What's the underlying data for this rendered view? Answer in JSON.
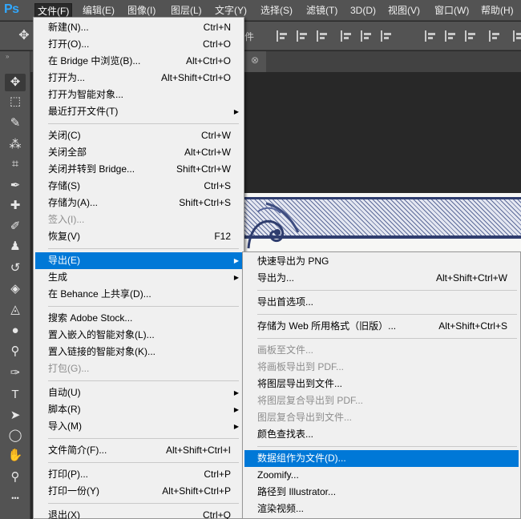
{
  "app": {
    "logo": "Ps"
  },
  "menubar": {
    "items": [
      {
        "label": "文件(F)"
      },
      {
        "label": "编辑(E)"
      },
      {
        "label": "图像(I)"
      },
      {
        "label": "图层(L)"
      },
      {
        "label": "文字(Y)"
      },
      {
        "label": "选择(S)"
      },
      {
        "label": "滤镜(T)"
      },
      {
        "label": "3D(D)"
      },
      {
        "label": "视图(V)"
      },
      {
        "label": "窗口(W)"
      },
      {
        "label": "帮助(H)"
      }
    ],
    "active_index": 0
  },
  "optionsbar": {
    "partial_label": "件"
  },
  "tab": {
    "close_glyph": "⊗"
  },
  "toolbox": {
    "collapse_glyph": "»",
    "tools": [
      {
        "icon": "move-tool-icon",
        "glyph": "✥"
      },
      {
        "icon": "marquee-tool-icon",
        "glyph": "⬚"
      },
      {
        "icon": "quick-select-tool-icon",
        "glyph": "✎"
      },
      {
        "icon": "magic-wand-tool-icon",
        "glyph": "⁂"
      },
      {
        "icon": "crop-tool-icon",
        "glyph": "⌗"
      },
      {
        "icon": "eyedropper-tool-icon",
        "glyph": "✒"
      },
      {
        "icon": "healing-brush-tool-icon",
        "glyph": "✚"
      },
      {
        "icon": "brush-tool-icon",
        "glyph": "✐"
      },
      {
        "icon": "clone-stamp-tool-icon",
        "glyph": "♟"
      },
      {
        "icon": "history-brush-tool-icon",
        "glyph": "↺"
      },
      {
        "icon": "eraser-tool-icon",
        "glyph": "◈"
      },
      {
        "icon": "paint-bucket-tool-icon",
        "glyph": "◬"
      },
      {
        "icon": "blur-tool-icon",
        "glyph": "●"
      },
      {
        "icon": "dodge-tool-icon",
        "glyph": "⚲"
      },
      {
        "icon": "pen-tool-icon",
        "glyph": "✑"
      },
      {
        "icon": "type-tool-icon",
        "glyph": "T"
      },
      {
        "icon": "path-select-tool-icon",
        "glyph": "➤"
      },
      {
        "icon": "ellipse-tool-icon",
        "glyph": "◯"
      },
      {
        "icon": "hand-tool-icon",
        "glyph": "✋"
      },
      {
        "icon": "zoom-tool-icon",
        "glyph": "⚲"
      },
      {
        "icon": "more-tools-icon",
        "glyph": "•••"
      }
    ]
  },
  "file_menu": {
    "items": [
      {
        "label": "新建(N)...",
        "shortcut": "Ctrl+N"
      },
      {
        "label": "打开(O)...",
        "shortcut": "Ctrl+O"
      },
      {
        "label": "在 Bridge 中浏览(B)...",
        "shortcut": "Alt+Ctrl+O"
      },
      {
        "label": "打开为...",
        "shortcut": "Alt+Shift+Ctrl+O"
      },
      {
        "label": "打开为智能对象...",
        "shortcut": ""
      },
      {
        "label": "最近打开文件(T)",
        "shortcut": "",
        "submenu": true
      },
      {
        "separator": true
      },
      {
        "label": "关闭(C)",
        "shortcut": "Ctrl+W"
      },
      {
        "label": "关闭全部",
        "shortcut": "Alt+Ctrl+W"
      },
      {
        "label": "关闭并转到 Bridge...",
        "shortcut": "Shift+Ctrl+W"
      },
      {
        "label": "存储(S)",
        "shortcut": "Ctrl+S"
      },
      {
        "label": "存储为(A)...",
        "shortcut": "Shift+Ctrl+S"
      },
      {
        "label": "签入(I)...",
        "shortcut": "",
        "disabled": true
      },
      {
        "label": "恢复(V)",
        "shortcut": "F12"
      },
      {
        "separator": true
      },
      {
        "label": "导出(E)",
        "shortcut": "",
        "submenu": true,
        "highlighted": true
      },
      {
        "label": "生成",
        "shortcut": "",
        "submenu": true
      },
      {
        "label": "在 Behance 上共享(D)...",
        "shortcut": ""
      },
      {
        "separator": true
      },
      {
        "label": "搜索 Adobe Stock...",
        "shortcut": ""
      },
      {
        "label": "置入嵌入的智能对象(L)...",
        "shortcut": ""
      },
      {
        "label": "置入链接的智能对象(K)...",
        "shortcut": ""
      },
      {
        "label": "打包(G)...",
        "shortcut": "",
        "disabled": true
      },
      {
        "separator": true
      },
      {
        "label": "自动(U)",
        "shortcut": "",
        "submenu": true
      },
      {
        "label": "脚本(R)",
        "shortcut": "",
        "submenu": true
      },
      {
        "label": "导入(M)",
        "shortcut": "",
        "submenu": true
      },
      {
        "separator": true
      },
      {
        "label": "文件简介(F)...",
        "shortcut": "Alt+Shift+Ctrl+I"
      },
      {
        "separator": true
      },
      {
        "label": "打印(P)...",
        "shortcut": "Ctrl+P"
      },
      {
        "label": "打印一份(Y)",
        "shortcut": "Alt+Shift+Ctrl+P"
      },
      {
        "separator": true
      },
      {
        "label": "退出(X)",
        "shortcut": "Ctrl+Q"
      }
    ]
  },
  "export_submenu": {
    "items": [
      {
        "label": "快速导出为 PNG",
        "shortcut": ""
      },
      {
        "label": "导出为...",
        "shortcut": "Alt+Shift+Ctrl+W"
      },
      {
        "separator": true
      },
      {
        "label": "导出首选项...",
        "shortcut": ""
      },
      {
        "separator": true
      },
      {
        "label": "存储为 Web 所用格式（旧版）...",
        "shortcut": "Alt+Shift+Ctrl+S"
      },
      {
        "separator": true
      },
      {
        "label": "画板至文件...",
        "shortcut": "",
        "disabled": true
      },
      {
        "label": "将画板导出到 PDF...",
        "shortcut": "",
        "disabled": true
      },
      {
        "label": "将图层导出到文件...",
        "shortcut": ""
      },
      {
        "label": "将图层复合导出到 PDF...",
        "shortcut": "",
        "disabled": true
      },
      {
        "label": "图层复合导出到文件...",
        "shortcut": "",
        "disabled": true
      },
      {
        "label": "颜色查找表...",
        "shortcut": ""
      },
      {
        "separator": true
      },
      {
        "label": "数据组作为文件(D)...",
        "shortcut": "",
        "highlighted": true
      },
      {
        "label": "Zoomify...",
        "shortcut": ""
      },
      {
        "label": "路径到 Illustrator...",
        "shortcut": ""
      },
      {
        "label": "渲染视频...",
        "shortcut": ""
      }
    ]
  },
  "colors": {
    "highlight": "#0078d7",
    "menu_bg": "#f0f0f0",
    "chrome": "#535353",
    "canvas": "#282828"
  }
}
